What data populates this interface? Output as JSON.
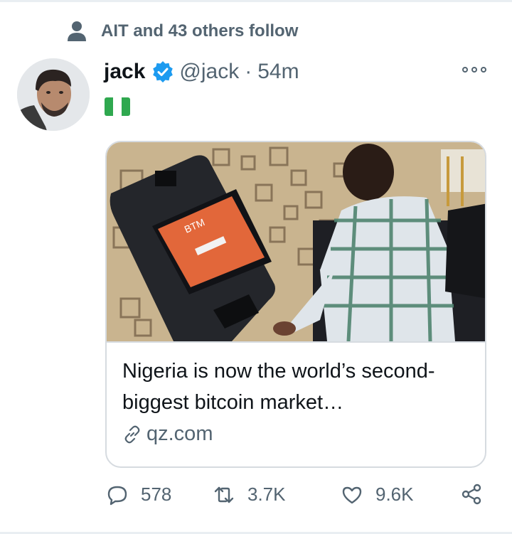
{
  "social_context": {
    "text": "AIT and 43 others follow",
    "icon": "person-icon"
  },
  "tweet": {
    "author_name": "jack",
    "verified": true,
    "handle": "@jack",
    "separator": "·",
    "time": "54m",
    "bio_flag": "nigeria-flag",
    "avatar": "avatar-jack"
  },
  "card": {
    "image_alt": "person-at-bitcoin-atm",
    "atm_screen_text": "BTM",
    "title": "Nigeria is now the world’s second-biggest bitcoin market…",
    "domain": "qz.com",
    "link_icon": "link-icon"
  },
  "actions": {
    "replies": "578",
    "retweets": "3.7K",
    "likes": "9.6K"
  },
  "colors": {
    "muted": "#536471",
    "verified_blue": "#1d9bf0",
    "flag_green": "#2fa84f",
    "atm_screen": "#e2673a",
    "card_border": "#d6dbe0"
  }
}
